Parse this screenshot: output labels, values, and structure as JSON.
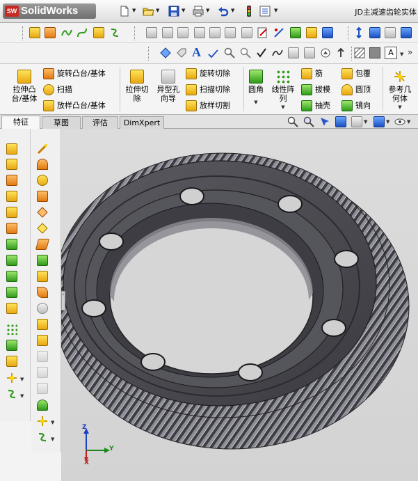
{
  "app": {
    "logo_text": "SolidWorks",
    "logo_mark": "SW",
    "document_title": "JD主减速齿轮实体"
  },
  "menu_icons": [
    "new-document-icon",
    "open-folder-icon",
    "save-icon",
    "print-icon",
    "undo-icon",
    "rebuild-traffic-light-icon",
    "options-icon"
  ],
  "command_manager": {
    "extrude_boss": "拉伸凸台/基体",
    "revolve_boss": "旋转凸台/基体",
    "sweep": "扫描",
    "loft_boss": "放样凸台/基体",
    "extrude_cut": "拉伸切除",
    "hole_wizard": "异型孔向导",
    "revolve_cut": "旋转切除",
    "sweep_cut": "扫描切除",
    "loft_cut": "放样切割",
    "fillet": "圆角",
    "linear_pattern": "线性阵列",
    "rib": "筋",
    "draft": "拔模",
    "shell": "抽壳",
    "wrap": "包覆",
    "dome": "圆顶",
    "mirror": "镜向",
    "ref_geometry": "参考几何体"
  },
  "tabs": [
    "特征",
    "草图",
    "评估",
    "DimXpert"
  ],
  "active_tab": "特征",
  "triad": {
    "x": "X",
    "y": "Y",
    "z": "Z"
  },
  "splitter_arrows": "›"
}
